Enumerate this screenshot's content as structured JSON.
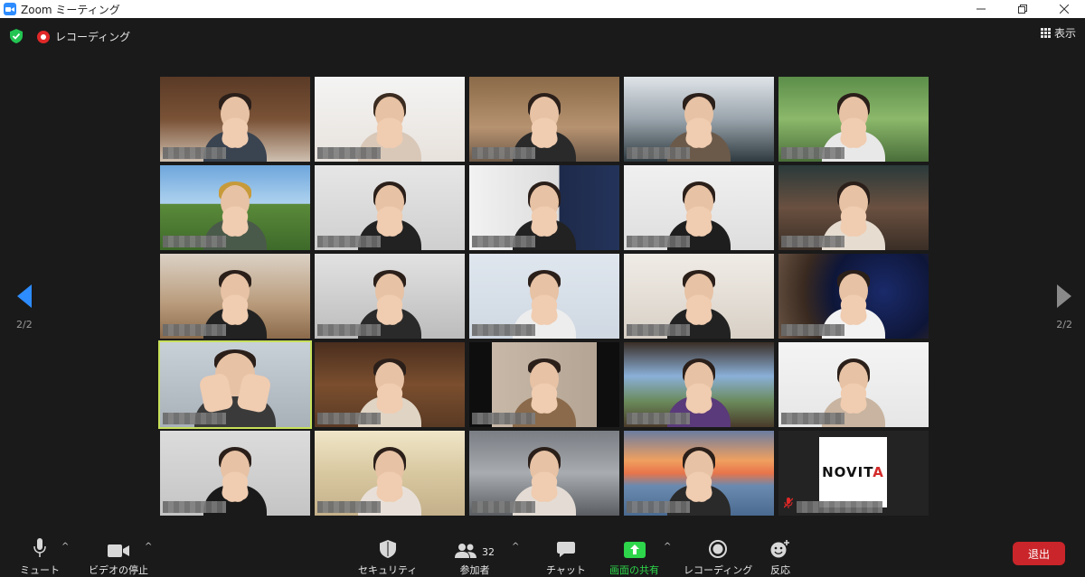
{
  "window": {
    "title": "Zoom ミーティング"
  },
  "status": {
    "recording_label": "レコーディング",
    "view_label": "表示"
  },
  "gallery": {
    "page_left": "2/2",
    "page_right": "2/2",
    "logo_text_main": "NOVIT",
    "logo_text_accent": "A"
  },
  "toolbar": {
    "mute_label": "ミュート",
    "video_label": "ビデオの停止",
    "security_label": "セキュリティ",
    "participants_label": "参加者",
    "participants_count": "32",
    "chat_label": "チャット",
    "share_label": "画面の共有",
    "record_label": "レコーディング",
    "reactions_label": "反応",
    "leave_label": "退出"
  },
  "colors": {
    "accent": "#2d8cff",
    "active_speaker": "#c7e05a",
    "share_green": "#2dd64a",
    "leave_red": "#c9252a",
    "record_red": "#e02828"
  }
}
